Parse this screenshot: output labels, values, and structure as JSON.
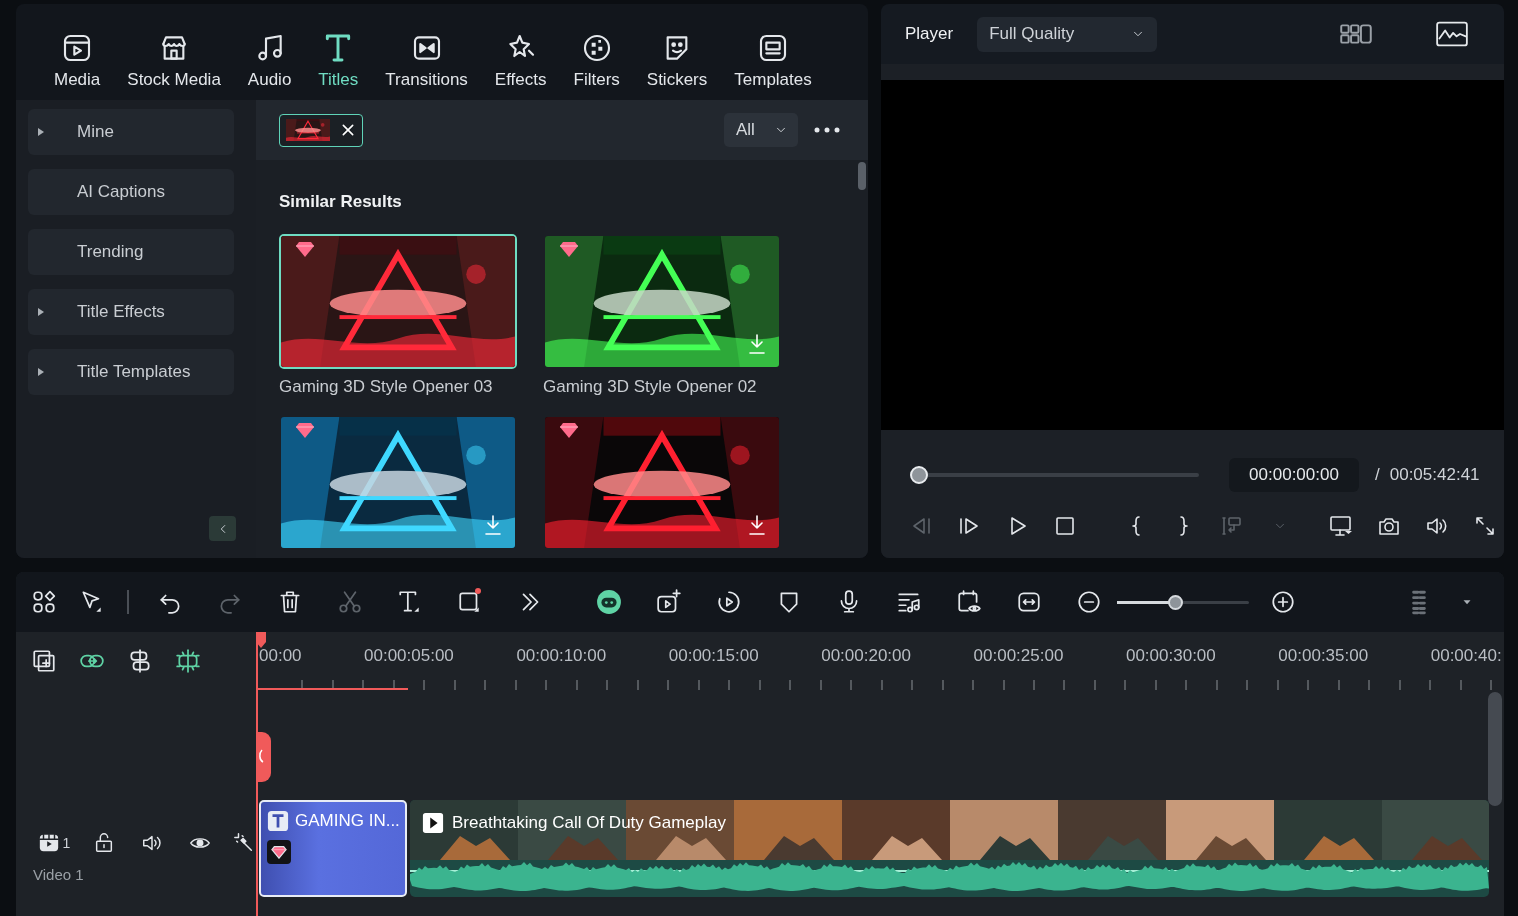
{
  "media_tabs": [
    {
      "label": "Media",
      "selected": false
    },
    {
      "label": "Stock Media",
      "selected": false
    },
    {
      "label": "Audio",
      "selected": false
    },
    {
      "label": "Titles",
      "selected": true
    },
    {
      "label": "Transitions",
      "selected": false
    },
    {
      "label": "Effects",
      "selected": false
    },
    {
      "label": "Filters",
      "selected": false
    },
    {
      "label": "Stickers",
      "selected": false
    },
    {
      "label": "Templates",
      "selected": false
    }
  ],
  "sidebar": {
    "items": [
      {
        "label": "Mine",
        "expandable": true
      },
      {
        "label": "AI Captions",
        "expandable": false
      },
      {
        "label": "Trending",
        "expandable": false
      },
      {
        "label": "Title Effects",
        "expandable": true
      },
      {
        "label": "Title Templates",
        "expandable": true
      }
    ]
  },
  "search": {
    "filter": "All"
  },
  "results": {
    "heading": "Similar Results",
    "items": [
      {
        "title": "Gaming 3D Style Opener 03",
        "selected": true,
        "premium": true,
        "download": false
      },
      {
        "title": "Gaming 3D Style Opener 02",
        "selected": false,
        "premium": true,
        "download": true
      },
      {
        "selected": false,
        "premium": true,
        "download": true
      },
      {
        "selected": false,
        "premium": true,
        "download": true
      }
    ]
  },
  "player": {
    "label": "Player",
    "quality": "Full Quality",
    "level": 0,
    "current_time": "00:00:00:00",
    "separator": "/",
    "total_time": "00:05:42:41",
    "controls": {
      "left": [
        {
          "kind": "prev-frame",
          "disabled": true
        },
        {
          "kind": "next-frame",
          "disabled": false
        },
        {
          "kind": "play",
          "disabled": false
        },
        {
          "kind": "stop",
          "disabled": false
        }
      ],
      "middle": [
        {
          "kind": "mark-in",
          "disabled": false
        },
        {
          "kind": "mark-out",
          "disabled": false
        },
        {
          "kind": "insert",
          "disabled": true
        },
        {
          "kind": "dropdown",
          "disabled": true
        }
      ],
      "right": [
        {
          "kind": "display",
          "disabled": false
        },
        {
          "kind": "snapshot",
          "disabled": false
        },
        {
          "kind": "volume",
          "disabled": false
        },
        {
          "kind": "fullscreen",
          "disabled": false
        }
      ]
    }
  },
  "timeline_toolbar": {
    "left": [
      {
        "kind": "apps"
      },
      {
        "kind": "select"
      }
    ],
    "edit": [
      {
        "kind": "undo",
        "disabled": false,
        "badge": false
      },
      {
        "kind": "redo",
        "disabled": true,
        "badge": false
      },
      {
        "kind": "delete",
        "disabled": false,
        "badge": false
      },
      {
        "kind": "cut",
        "disabled": true,
        "badge": false
      },
      {
        "kind": "text",
        "disabled": false,
        "badge": false
      },
      {
        "kind": "crop",
        "disabled": false,
        "badge": true
      },
      {
        "kind": "more",
        "disabled": false,
        "badge": false
      }
    ],
    "center": [
      {
        "kind": "ai-mate"
      },
      {
        "kind": "ai-video"
      },
      {
        "kind": "play-circle"
      },
      {
        "kind": "mask"
      },
      {
        "kind": "record"
      },
      {
        "kind": "music"
      },
      {
        "kind": "preview"
      },
      {
        "kind": "fit"
      },
      {
        "kind": "zoom-out"
      },
      {
        "kind": "zoom-slider",
        "level": 0.44
      },
      {
        "kind": "zoom-in"
      }
    ],
    "right": [
      {
        "kind": "layout"
      },
      {
        "kind": "dropdown"
      }
    ]
  },
  "timeline": {
    "tools": [
      {
        "kind": "add-track",
        "on": false
      },
      {
        "kind": "link",
        "on": true
      },
      {
        "kind": "ripple",
        "on": false
      },
      {
        "kind": "snap",
        "on": true
      }
    ],
    "ruler": [
      "00:00",
      "00:00:05:00",
      "00:00:10:00",
      "00:00:15:00",
      "00:00:20:00",
      "00:00:25:00",
      "00:00:30:00",
      "00:00:35:00",
      "00:00:40:"
    ],
    "tracks": [
      {
        "number": "1",
        "name": "Video 1",
        "clips": [
          {
            "kind": "title",
            "label": "GAMING IN...",
            "premium": true,
            "selected": true
          },
          {
            "kind": "video",
            "label": "Breathtaking Call Of Duty Gameplay",
            "selected": false
          }
        ]
      }
    ]
  }
}
